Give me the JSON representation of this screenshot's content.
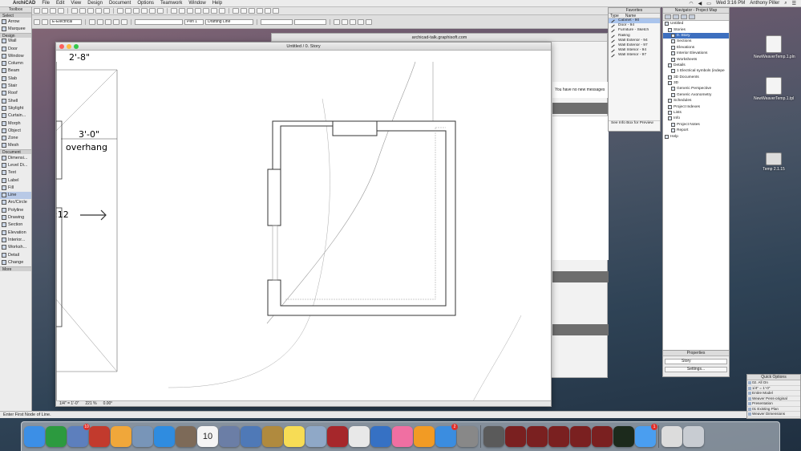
{
  "menubar": {
    "app_name": "ArchiCAD",
    "menus": [
      "File",
      "Edit",
      "View",
      "Design",
      "Document",
      "Options",
      "Teamwork",
      "Window",
      "Help"
    ],
    "clock": "Wed 3:16 PM",
    "user": "Anthony Piller"
  },
  "toolbar": {
    "layer_value": "E-Electrical",
    "line_type": "Drafting Line",
    "pen_label": "Pen 1"
  },
  "toolbox": {
    "title": "Toolbox",
    "select_label": "Select",
    "sections": {
      "design": "Design",
      "document": "Document",
      "more": "More"
    },
    "select_tools": [
      "Arrow",
      "Marquee"
    ],
    "design_tools": [
      "Wall",
      "Door",
      "Window",
      "Column",
      "Beam",
      "Slab",
      "Stair",
      "Roof",
      "Shell",
      "Skylight",
      "Curtain...",
      "Morph",
      "Object",
      "Zone",
      "Mesh"
    ],
    "document_tools": [
      "Dimensi...",
      "Level Di...",
      "Text",
      "Label",
      "Fill",
      "Line",
      "Arc/Circle",
      "Polyline",
      "Drawing",
      "Section",
      "Elevation",
      "Interior...",
      "Worksh...",
      "Detail",
      "Change"
    ],
    "active_tool": "Line"
  },
  "drawing_window": {
    "title": "Untitled / 0. Story",
    "dim_top": "2'-8\"",
    "dim_left": "3'-0\"",
    "overhang_label": "overhang",
    "slope_label": ":12",
    "status": {
      "scale": "1/4\" = 1'-0\"",
      "zoom": "221 %",
      "angle": "0.00°"
    }
  },
  "browser": {
    "url": "archicad-talk.graphisoft.com",
    "message": "You have no new messages"
  },
  "favorites": {
    "title": "Favorites",
    "col_type": "Type",
    "col_name": "Name",
    "items": [
      "Cabinet - 90",
      "Door - 94",
      "Furniture - Sketch",
      "Railing",
      "Wall Exterior - 94",
      "Wall Exterior - 97",
      "Wall Interior - 94",
      "Wall Interior - 97"
    ],
    "selected_index": 0,
    "footer": "See Info Box for Preview"
  },
  "navigator": {
    "title": "Navigator - Project Map",
    "items": [
      "Untitled",
      "Stories",
      "0. Story",
      "Sections",
      "Elevations",
      "Interior Elevations",
      "Worksheets",
      "Details",
      "1 Electrical symbols (indepe",
      "3D Documents",
      "3D",
      "Generic Perspective",
      "Generic Axonometry",
      "Schedules",
      "Project Indexes",
      "Lists",
      "Info",
      "Project Notes",
      "Report",
      "Help"
    ],
    "selected_index": 2
  },
  "properties": {
    "title": "Properties",
    "story_value": "Story",
    "settings_label": "Settings..."
  },
  "quick_options": {
    "title": "Quick Options",
    "rows": [
      "02. All On",
      "1/4\" = 1'-0\"",
      "Entire Model",
      "Weaver Pens-original",
      "Presentation",
      "01 Existing Plan",
      "Weaver Dimensions"
    ]
  },
  "desktop": {
    "icons": [
      {
        "label": "NewWeaverTemp.1.pln",
        "icon": "archicad-file-icon"
      },
      {
        "label": "NewWeaverTemp.1.tpl",
        "icon": "archicad-template-icon"
      },
      {
        "label": "Temp 2.1.15",
        "icon": "drive-icon"
      }
    ]
  },
  "status_message": "Enter First Node of Line.",
  "dock": {
    "apps": [
      {
        "name": "finder-icon",
        "color": "#3c8fe6"
      },
      {
        "name": "numbers-icon",
        "color": "#2c9a3f"
      },
      {
        "name": "archicad-icon",
        "color": "#5d7fbd",
        "badge": "10"
      },
      {
        "name": "sketchup-icon",
        "color": "#c23a2d"
      },
      {
        "name": "photos-icon",
        "color": "#f0a73a"
      },
      {
        "name": "preview-icon",
        "color": "#7895b8"
      },
      {
        "name": "safari-icon",
        "color": "#2f8ce0"
      },
      {
        "name": "gimp-icon",
        "color": "#7d6a58"
      },
      {
        "name": "calendar-icon",
        "color": "#f4f4f4",
        "date": "10"
      },
      {
        "name": "launchpad-icon",
        "color": "#6b7ea6"
      },
      {
        "name": "xcode-icon",
        "color": "#4f79b7"
      },
      {
        "name": "notebook-icon",
        "color": "#b08a3e"
      },
      {
        "name": "notes-icon",
        "color": "#f7dc55"
      },
      {
        "name": "image-capture-icon",
        "color": "#8fa8c7"
      },
      {
        "name": "photo-booth-icon",
        "color": "#a6272b"
      },
      {
        "name": "textedit-icon",
        "color": "#e8e8e8"
      },
      {
        "name": "keynote-icon",
        "color": "#3671c4"
      },
      {
        "name": "itunes-icon",
        "color": "#f06fa2"
      },
      {
        "name": "ibooks-icon",
        "color": "#f29b24"
      },
      {
        "name": "app-store-icon",
        "color": "#3b8de0",
        "badge": "2"
      },
      {
        "name": "system-preferences-icon",
        "color": "#888"
      },
      {
        "name": "window-thumb-1",
        "color": "#5a5a5a"
      },
      {
        "name": "window-thumb-2",
        "color": "#7a2020"
      },
      {
        "name": "window-thumb-3",
        "color": "#7a2020"
      },
      {
        "name": "window-thumb-4",
        "color": "#7a2020"
      },
      {
        "name": "window-thumb-5",
        "color": "#7a2020"
      },
      {
        "name": "window-thumb-6",
        "color": "#7a2020"
      },
      {
        "name": "activity-monitor-icon",
        "color": "#1c2a1c"
      },
      {
        "name": "messages-icon",
        "color": "#4a9ef0",
        "badge": "1"
      },
      {
        "name": "downloads-icon",
        "color": "#dcdcdc"
      },
      {
        "name": "trash-icon",
        "color": "#c8ccd2"
      }
    ]
  },
  "colors": {
    "selection": "#3d6fbf",
    "badge": "#e0302a",
    "wall_fill": "#ffffff",
    "wall_stroke": "#333333"
  }
}
